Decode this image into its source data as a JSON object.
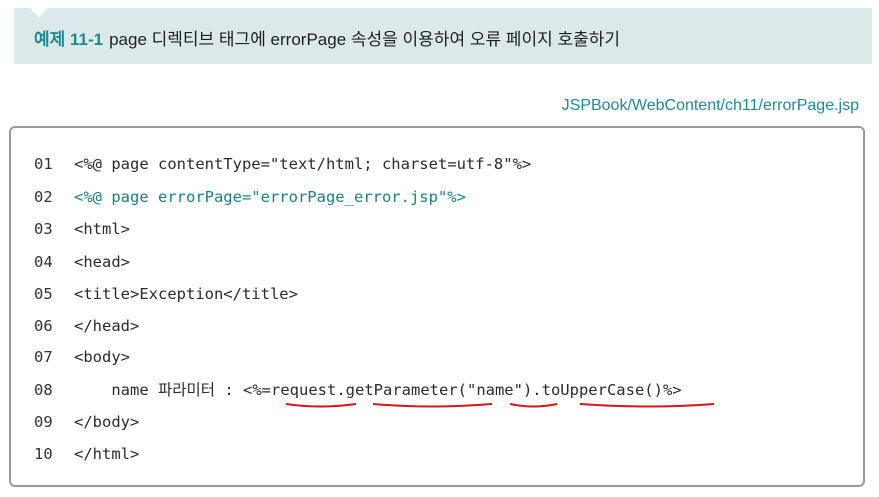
{
  "example": {
    "number": "예제 11-1",
    "title": "page 디렉티브 태그에 errorPage 속성을 이용하여 오류 페이지 호출하기"
  },
  "file_path": "JSPBook/WebContent/ch11/errorPage.jsp",
  "code_lines": [
    {
      "num": "01",
      "text": "<%@ page contentType=\"text/html; charset=utf-8\"%>",
      "highlight": false
    },
    {
      "num": "02",
      "text": "<%@ page errorPage=\"errorPage_error.jsp\"%>",
      "highlight": true
    },
    {
      "num": "03",
      "text": "<html>",
      "highlight": false
    },
    {
      "num": "04",
      "text": "<head>",
      "highlight": false
    },
    {
      "num": "05",
      "text": "<title>Exception</title>",
      "highlight": false
    },
    {
      "num": "06",
      "text": "</head>",
      "highlight": false
    },
    {
      "num": "07",
      "text": "<body>",
      "highlight": false
    },
    {
      "num": "08",
      "text": "    name 파라미터 : <%=request.getParameter(\"name\").toUpperCase()%>",
      "highlight": false
    },
    {
      "num": "09",
      "text": "</body>",
      "highlight": false
    },
    {
      "num": "10",
      "text": "</html>",
      "highlight": false
    }
  ],
  "colors": {
    "accent": "#1f8a8f",
    "header_band": "#dbe9ea",
    "annotation_red": "#d4161b"
  },
  "annotations": {
    "underlined_tokens": [
      "request",
      "getParameter",
      "name",
      "toUpperCase()"
    ]
  }
}
